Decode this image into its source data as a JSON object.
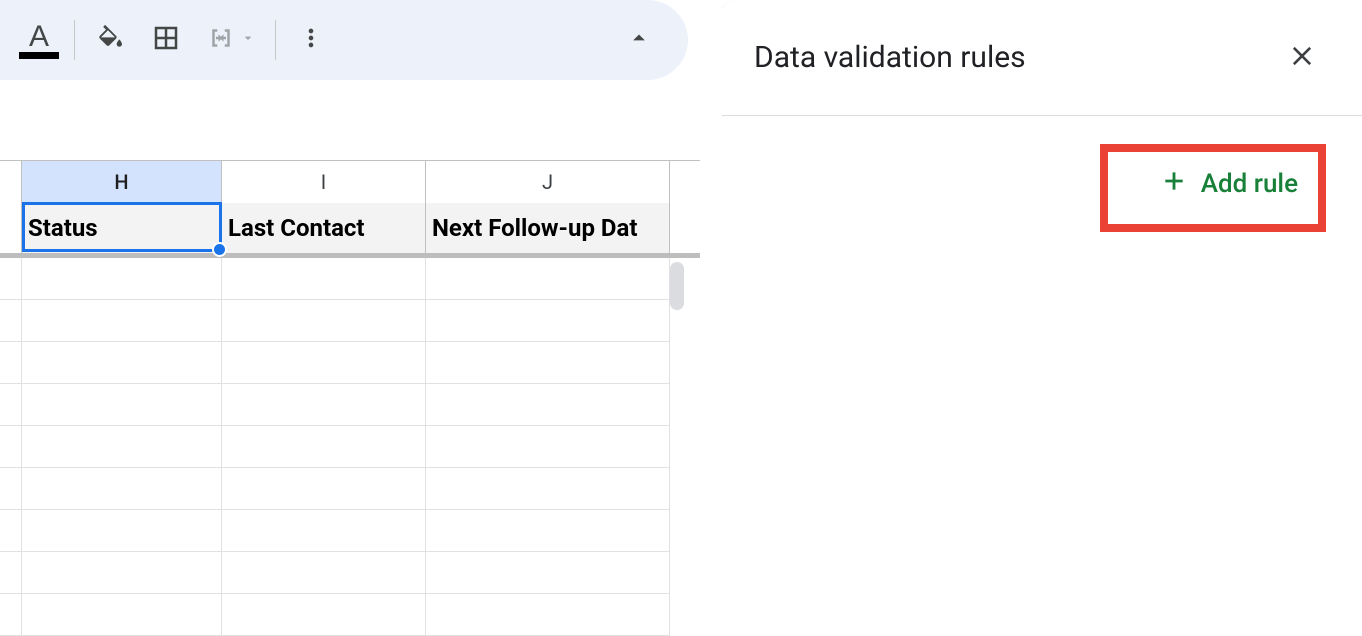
{
  "toolbar": {
    "text_color_label": "A"
  },
  "columns": {
    "h": "H",
    "i": "I",
    "j": "J"
  },
  "headers": {
    "status": "Status",
    "last_contact": "Last Contact",
    "next_followup": "Next Follow-up Dat"
  },
  "panel": {
    "title": "Data validation rules",
    "add_rule": "Add rule"
  }
}
